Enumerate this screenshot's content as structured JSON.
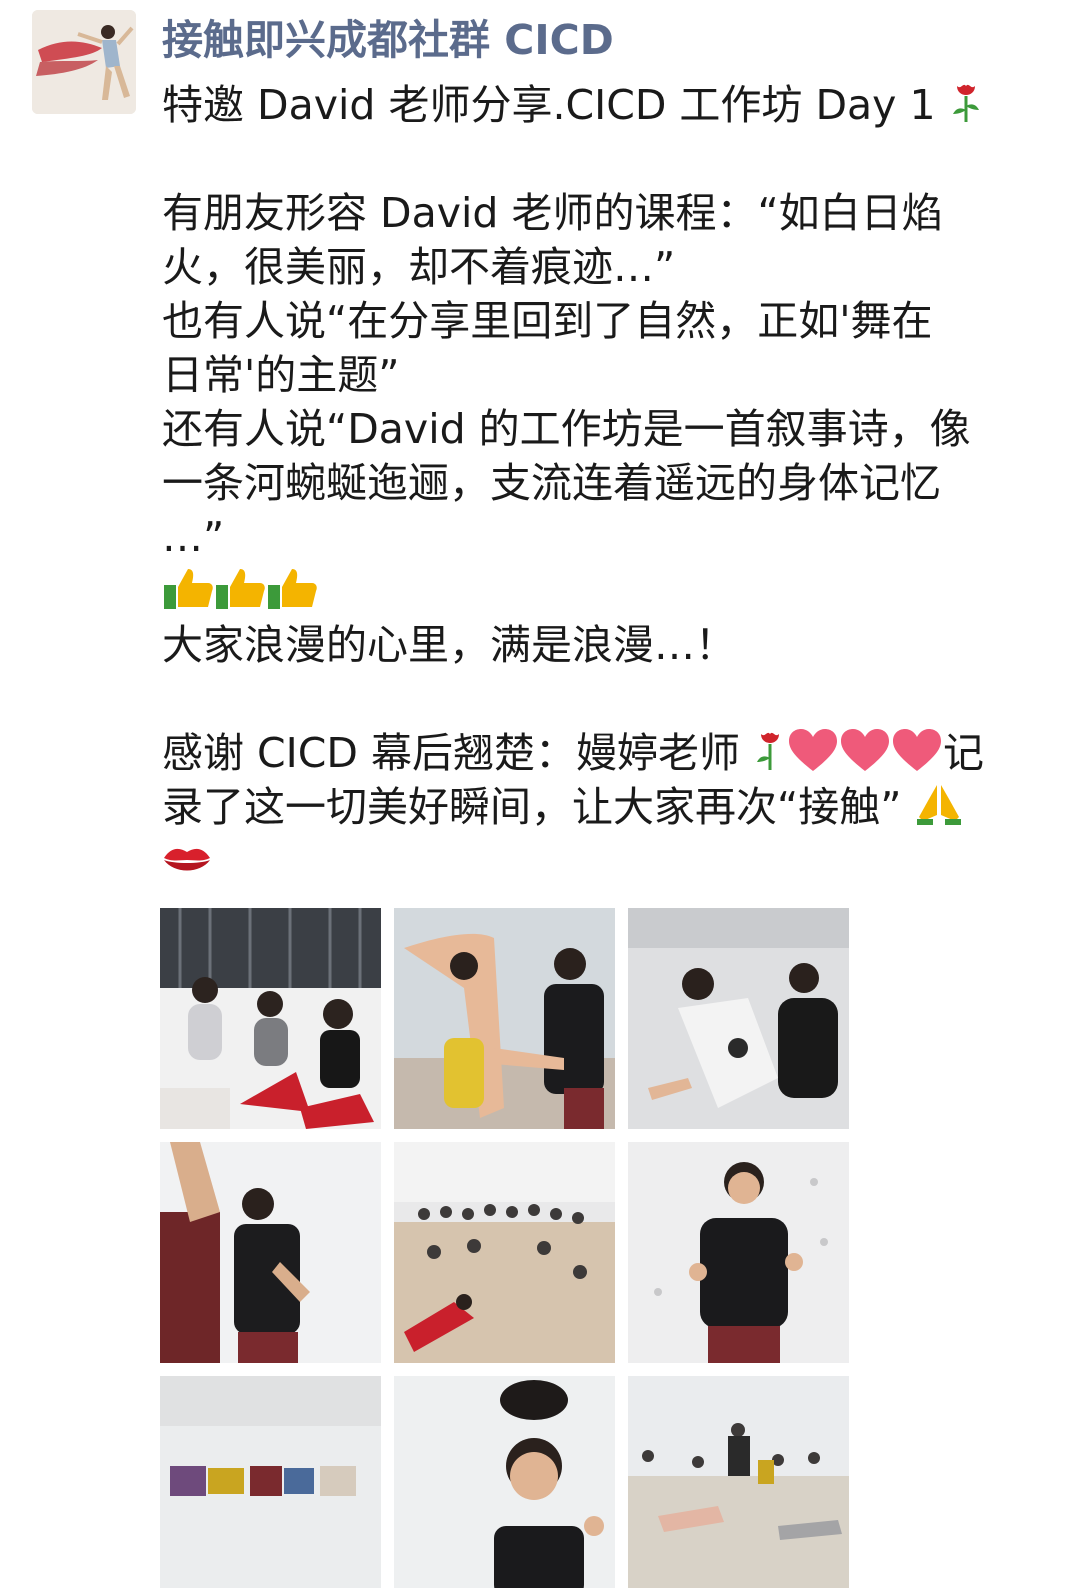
{
  "post": {
    "author_name": "接触即兴成都社群 CICD",
    "lines": [
      "特邀 David 老师分享.CICD 工作坊 Day 1",
      "",
      "有朋友形容 David 老师的课程：“如白日焰",
      "火，很美丽，却不着痕迹…”",
      "也有人说“在分享里回到了自然，正如'舞在",
      "日常'的主题”",
      "还有人说“David 的工作坊是一首叙事诗，像",
      "一条河蜿蜒迤逦，支流连着遥远的身体记忆",
      "…”",
      "",
      "大家浪漫的心里，满是浪漫…！",
      "",
      "感谢 CICD 幕后翘楚：嫚婷老师",
      "记",
      "录了这一切美好瞬间，让大家再次“接触”"
    ]
  },
  "icons": {
    "rose": "rose-icon",
    "thumbs_up": "thumbs-up-icon",
    "heart": "heart-icon",
    "pray": "folded-hands-icon",
    "lips": "lips-icon"
  },
  "colors": {
    "author": "#5b6b8c",
    "text": "#1a1a1a",
    "heart": "#ef5a7a",
    "rose": "#d0242c",
    "leaf": "#3c9a3a",
    "thumb": "#f4b400",
    "lips": "#d8202c"
  }
}
